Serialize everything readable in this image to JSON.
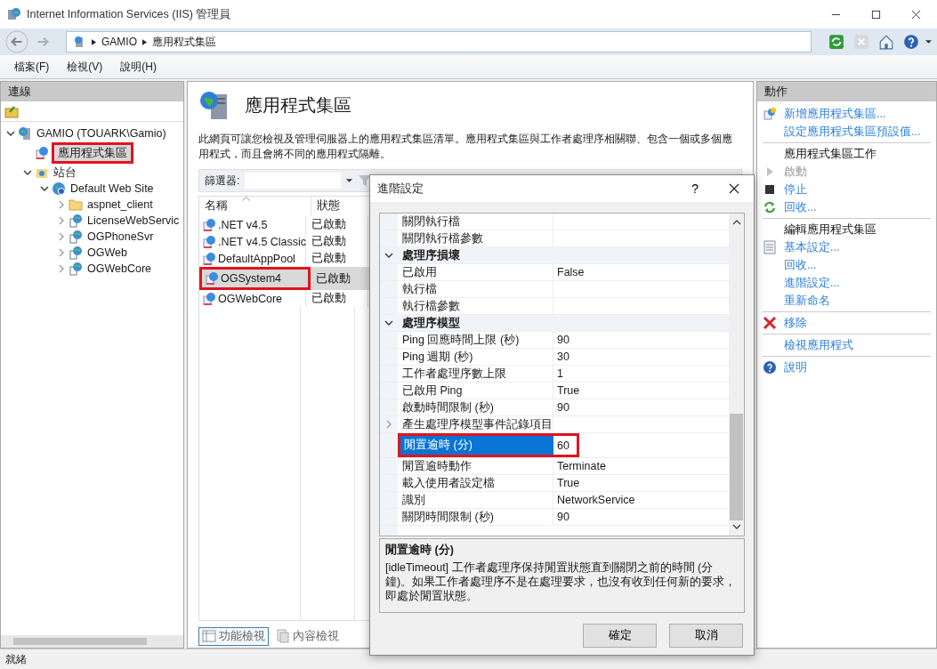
{
  "window": {
    "title": "Internet Information Services (IIS) 管理員"
  },
  "address": {
    "crumbs": [
      "GAMIO",
      "應用程式集區"
    ]
  },
  "menu": [
    "檔案(F)",
    "檢視(V)",
    "說明(H)"
  ],
  "connections": {
    "title": "連線",
    "tree": [
      {
        "kind": "server",
        "label": "GAMIO (TOUARK\\Gamio)",
        "expanded": true,
        "selected": false,
        "highlighted": false,
        "children": [
          {
            "kind": "pools",
            "label": "應用程式集區",
            "selected": true,
            "highlighted": true
          },
          {
            "kind": "sites",
            "label": "站台",
            "expanded": true,
            "selected": false,
            "highlighted": false,
            "children": [
              {
                "kind": "site",
                "label": "Default Web Site",
                "expanded": true,
                "selected": false,
                "highlighted": false,
                "children": [
                  {
                    "kind": "folder",
                    "label": "aspnet_client",
                    "expanded": false,
                    "selected": false,
                    "highlighted": false
                  },
                  {
                    "kind": "app",
                    "label": "LicenseWebServic",
                    "expanded": false,
                    "selected": false,
                    "highlighted": false
                  },
                  {
                    "kind": "app",
                    "label": "OGPhoneSvr",
                    "expanded": false,
                    "selected": false,
                    "highlighted": false
                  },
                  {
                    "kind": "app",
                    "label": "OGWeb",
                    "expanded": false,
                    "selected": false,
                    "highlighted": false
                  },
                  {
                    "kind": "app",
                    "label": "OGWebCore",
                    "expanded": false,
                    "selected": false,
                    "highlighted": false
                  }
                ]
              }
            ]
          }
        ]
      }
    ]
  },
  "page": {
    "title": "應用程式集區",
    "description": "此網頁可讓您檢視及管理伺服器上的應用程式集區清單。應用程式集區與工作者處理序相關聯、包含一個或多個應用程式，而且會將不同的應用程式隔離。",
    "filter_label": "篩選器:",
    "columns": [
      "名稱",
      "狀態"
    ],
    "rows": [
      {
        "name": ".NET v4.5",
        "status": "已啟動",
        "selected": false,
        "highlighted": false
      },
      {
        "name": ".NET v4.5 Classic",
        "status": "已啟動",
        "selected": false,
        "highlighted": false
      },
      {
        "name": "DefaultAppPool",
        "status": "已啟動",
        "selected": false,
        "highlighted": false
      },
      {
        "name": "OGSystem4",
        "status": "已啟動",
        "selected": true,
        "highlighted": true
      },
      {
        "name": "OGWebCore",
        "status": "已啟動",
        "selected": false,
        "highlighted": false
      }
    ],
    "view_tabs": [
      {
        "label": "功能檢視",
        "selected": true
      },
      {
        "label": "內容檢視",
        "selected": false
      }
    ]
  },
  "actions": {
    "title": "動作",
    "items": [
      {
        "kind": "add",
        "label": "新增應用程式集區...",
        "disabled": false
      },
      {
        "kind": "link",
        "label": "設定應用程式集區預設值...",
        "disabled": false
      },
      {
        "kind": "heading",
        "label": "應用程式集區工作"
      },
      {
        "kind": "start",
        "label": "啟動",
        "disabled": true
      },
      {
        "kind": "stop",
        "label": "停止",
        "disabled": false
      },
      {
        "kind": "recycle",
        "label": "回收...",
        "disabled": false
      },
      {
        "kind": "heading",
        "label": "編輯應用程式集區"
      },
      {
        "kind": "settings",
        "label": "基本設定...",
        "disabled": false
      },
      {
        "kind": "link",
        "label": "回收...",
        "disabled": false
      },
      {
        "kind": "link",
        "label": "進階設定...",
        "disabled": false
      },
      {
        "kind": "link",
        "label": "重新命名",
        "disabled": false
      },
      {
        "kind": "remove",
        "label": "移除",
        "disabled": false
      },
      {
        "kind": "link",
        "label": "檢視應用程式",
        "disabled": false
      },
      {
        "kind": "help",
        "label": "說明",
        "disabled": false
      }
    ]
  },
  "dialog": {
    "title": "進階設定",
    "help": "?",
    "grid": [
      {
        "kind": "property",
        "name": "關閉執行檔",
        "selected": false,
        "highlighted": false
      },
      {
        "kind": "property",
        "name": "關閉執行檔參數",
        "selected": false,
        "highlighted": false
      },
      {
        "kind": "category",
        "name": "處理序損壞",
        "expanded": true,
        "selected": false,
        "highlighted": false
      },
      {
        "kind": "property",
        "name": "已啟用",
        "value": "False",
        "selected": false,
        "highlighted": false
      },
      {
        "kind": "property",
        "name": "執行檔",
        "selected": false,
        "highlighted": false
      },
      {
        "kind": "property",
        "name": "執行檔參數",
        "selected": false,
        "highlighted": false
      },
      {
        "kind": "category",
        "name": "處理序模型",
        "expanded": true,
        "selected": false,
        "highlighted": false
      },
      {
        "kind": "property",
        "name": "Ping 回應時間上限 (秒)",
        "value": "90",
        "selected": false,
        "highlighted": false
      },
      {
        "kind": "property",
        "name": "Ping 週期 (秒)",
        "value": "30",
        "selected": false,
        "highlighted": false
      },
      {
        "kind": "property",
        "name": "工作者處理序數上限",
        "value": "1",
        "selected": false,
        "highlighted": false
      },
      {
        "kind": "property",
        "name": "已啟用 Ping",
        "value": "True",
        "selected": false,
        "highlighted": false
      },
      {
        "kind": "property",
        "name": "啟動時間限制 (秒)",
        "value": "90",
        "selected": false,
        "highlighted": false
      },
      {
        "kind": "group",
        "name": "產生處理序模型事件記錄項目",
        "expanded": false,
        "selected": false,
        "highlighted": false
      },
      {
        "kind": "property",
        "name": "閒置逾時 (分)",
        "value": "60",
        "selected": true,
        "highlighted": true
      },
      {
        "kind": "property",
        "name": "閒置逾時動作",
        "value": "Terminate",
        "selected": false,
        "highlighted": false
      },
      {
        "kind": "property",
        "name": "載入使用者設定檔",
        "value": "True",
        "selected": false,
        "highlighted": false
      },
      {
        "kind": "property",
        "name": "識別",
        "value": "NetworkService",
        "selected": false,
        "highlighted": false
      },
      {
        "kind": "property",
        "name": "關閉時間限制 (秒)",
        "value": "90",
        "selected": false,
        "highlighted": false
      }
    ],
    "info_title": "閒置逾時 (分)",
    "info_text": "[idleTimeout] 工作者處理序保持閒置狀態直到關閉之前的時間 (分鐘)。如果工作者處理序不是在處理要求，也沒有收到任何新的要求，即處於閒置狀態。",
    "buttons": [
      "確定",
      "取消"
    ]
  },
  "status_bar": "就緒"
}
